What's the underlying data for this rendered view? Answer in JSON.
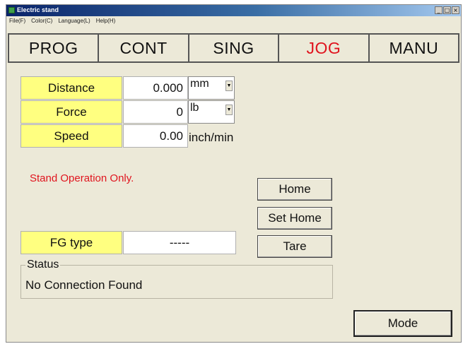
{
  "window": {
    "title": "Electric stand",
    "controls": [
      "_",
      "□",
      "×"
    ]
  },
  "menu": [
    "File(F)",
    "Color(C)",
    "Language(L)",
    "Help(H)"
  ],
  "tabs": [
    {
      "label": "PROG"
    },
    {
      "label": "CONT"
    },
    {
      "label": "SING"
    },
    {
      "label": "JOG",
      "active": true
    },
    {
      "label": "MANU"
    }
  ],
  "fields": {
    "distance": {
      "label": "Distance",
      "value": "0.000",
      "unit": "mm"
    },
    "force": {
      "label": "Force",
      "value": "0",
      "unit": "lb"
    },
    "speed": {
      "label": "Speed",
      "value": "0.00",
      "unit": "inch/min"
    },
    "fg_type": {
      "label": "FG type",
      "value": "-----"
    }
  },
  "message": "Stand Operation Only.",
  "buttons": {
    "home": "Home",
    "set_home": "Set Home",
    "tare": "Tare",
    "mode": "Mode"
  },
  "status": {
    "legend": "Status",
    "text": "No Connection Found"
  },
  "colors": {
    "label_bg": "#ffff80",
    "active_tab": "#e0141e",
    "message": "#e0141e",
    "window_bg": "#ece9d8"
  }
}
